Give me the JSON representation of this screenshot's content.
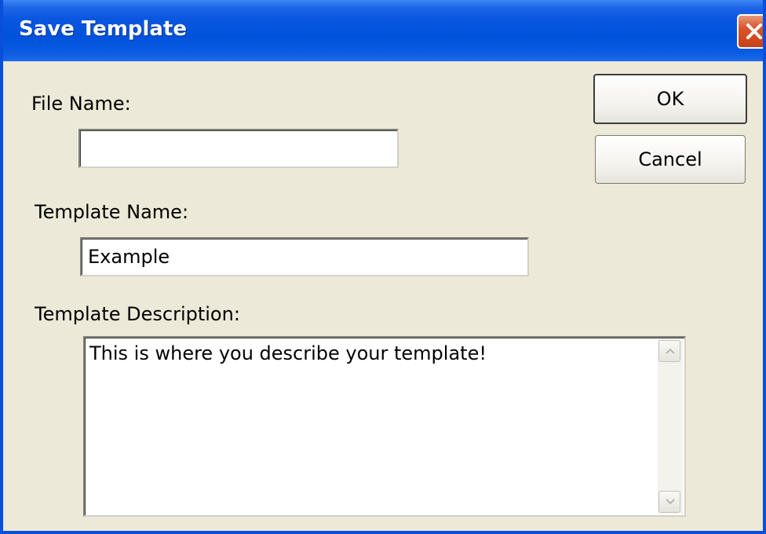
{
  "window": {
    "title": "Save Template"
  },
  "form": {
    "file_name_label": "File Name:",
    "file_name_value": "",
    "template_name_label": "Template Name:",
    "template_name_value": "Example",
    "template_description_label": "Template Description:",
    "template_description_value": "This is where you describe your template!"
  },
  "buttons": {
    "ok_label": "OK",
    "cancel_label": "Cancel"
  },
  "icons": {
    "close": "close-icon",
    "scroll_up": "scroll-up-arrow-icon",
    "scroll_down": "scroll-down-arrow-icon"
  },
  "colors": {
    "titlebar": "#0052dc",
    "close_button": "#d8552a",
    "dialog_background": "#ece9d8"
  }
}
